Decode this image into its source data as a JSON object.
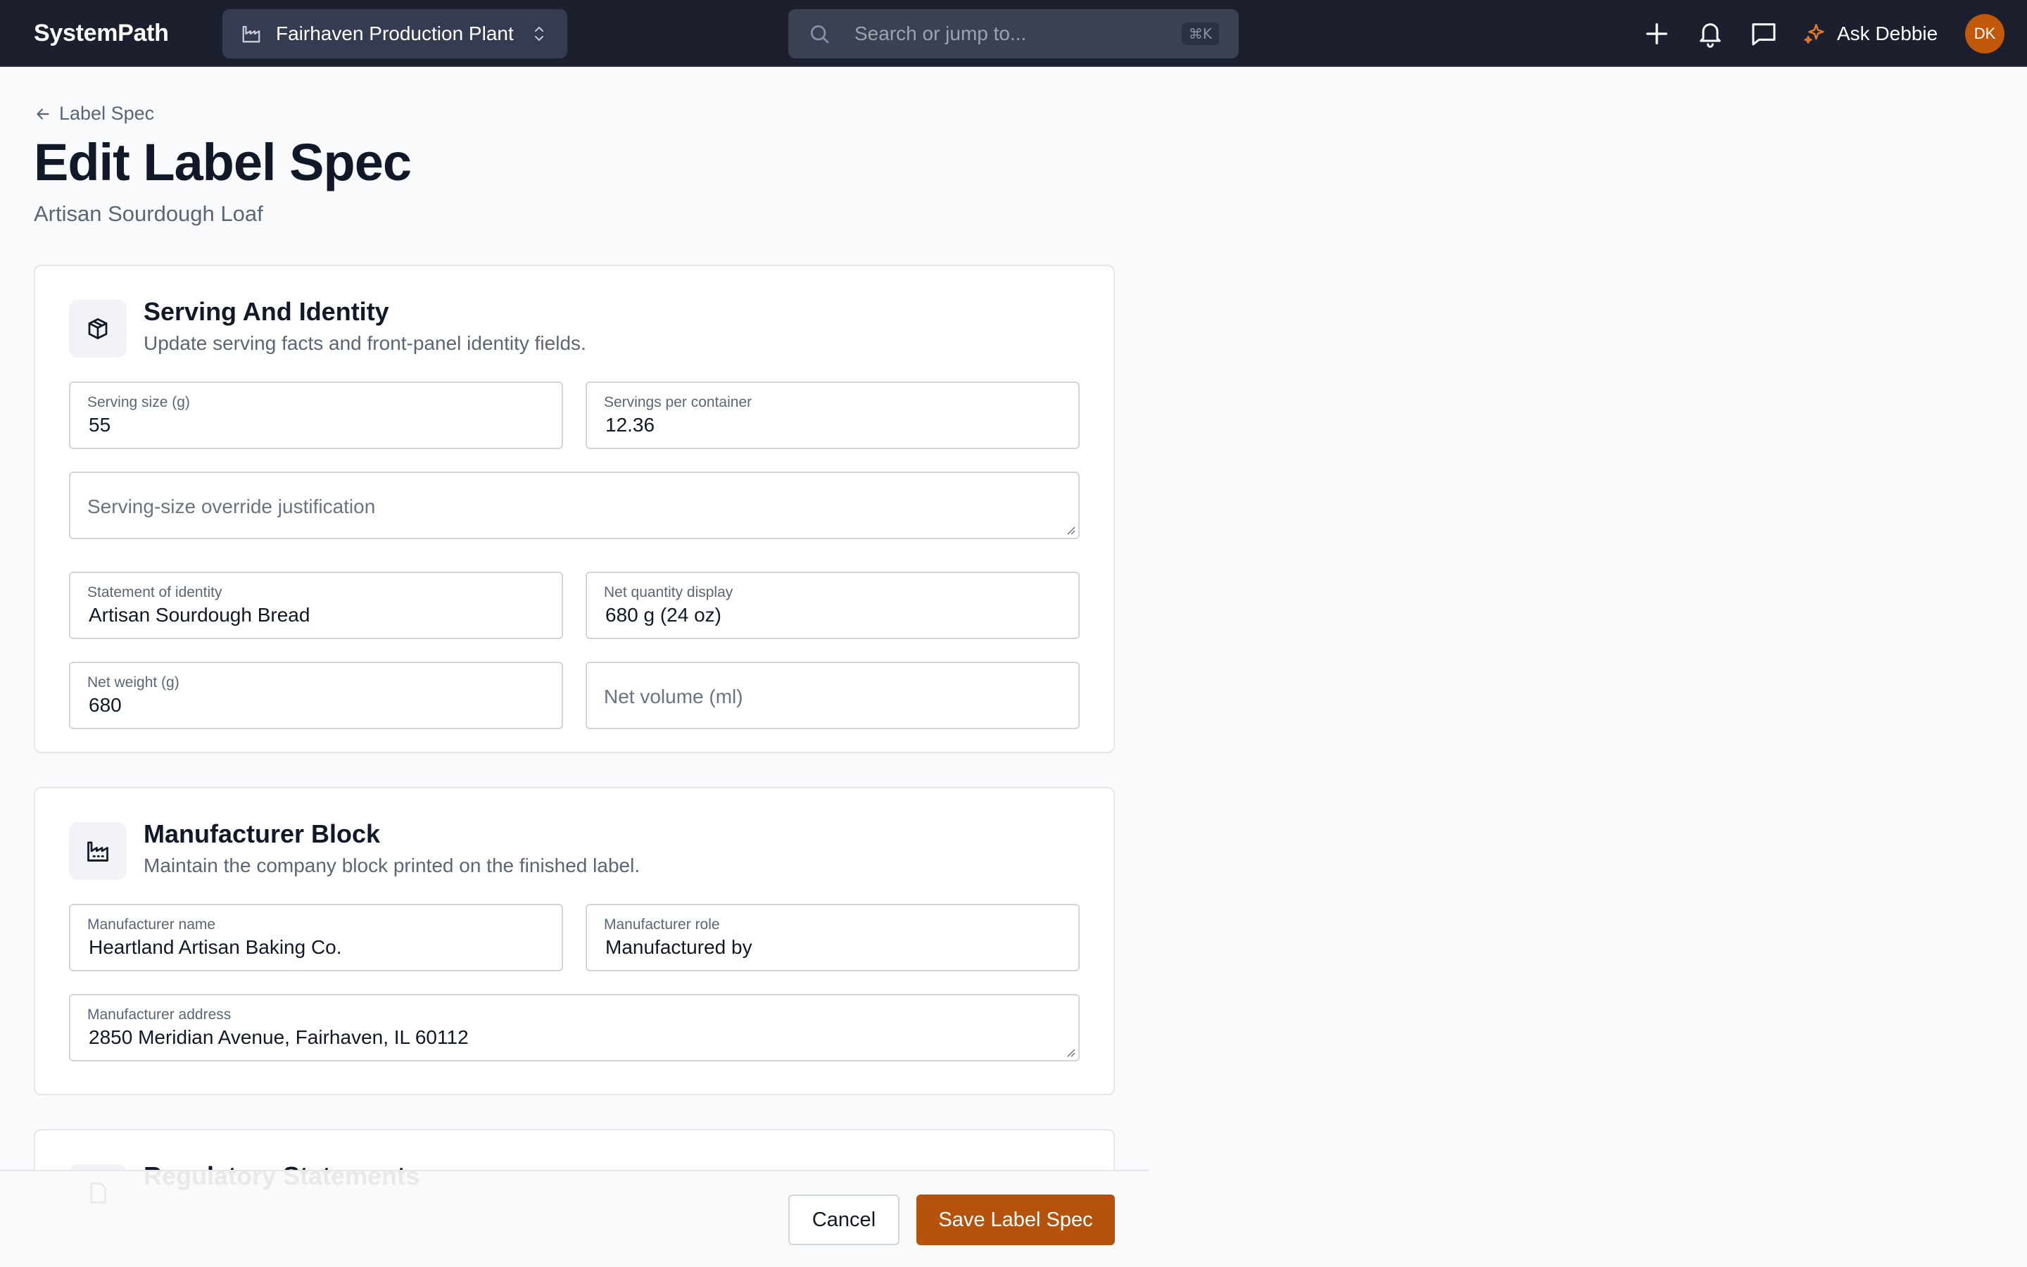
{
  "app": {
    "logo": "SystemPath",
    "plant_selector": "Fairhaven Production Plant",
    "search_placeholder": "Search or jump to...",
    "search_shortcut": "⌘K",
    "ask_label": "Ask Debbie",
    "avatar_initials": "DK",
    "icons": [
      "plus-icon",
      "bell-icon",
      "chat-icon",
      "sparkle-icon"
    ]
  },
  "header": {
    "back_label": "Label Spec",
    "title": "Edit Label Spec",
    "subtitle": "Artisan Sourdough Loaf"
  },
  "serving": {
    "title": "Serving And Identity",
    "description": "Update serving facts and front-panel identity fields.",
    "serving_size_label": "Serving size (g)",
    "serving_size_value": "55",
    "servings_per_container_label": "Servings per container",
    "servings_per_container_value": "12.36",
    "override_placeholder": "Serving-size override justification",
    "identity_label": "Statement of identity",
    "identity_value": "Artisan Sourdough Bread",
    "net_qty_label": "Net quantity display",
    "net_qty_value": "680 g (24 oz)",
    "net_weight_label": "Net weight (g)",
    "net_weight_value": "680",
    "net_volume_placeholder": "Net volume (ml)"
  },
  "manufacturer": {
    "title": "Manufacturer Block",
    "description": "Maintain the company block printed on the finished label.",
    "name_label": "Manufacturer name",
    "name_value": "Heartland Artisan Baking Co.",
    "role_label": "Manufacturer role",
    "role_value": "Manufactured by",
    "address_label": "Manufacturer address",
    "address_value": "2850 Meridian Avenue, Fairhaven, IL 60112"
  },
  "regulatory": {
    "title": "Regulatory Statements"
  },
  "footer": {
    "cancel_label": "Cancel",
    "save_label": "Save Label Spec"
  },
  "colors": {
    "topbar": "#1c1f2e",
    "accent": "#b5530c",
    "avatar": "#c2590a"
  }
}
